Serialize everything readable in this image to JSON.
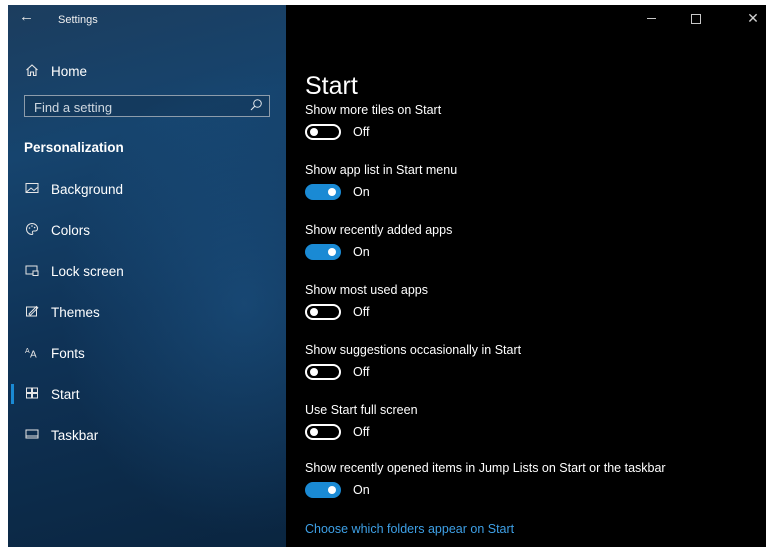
{
  "window": {
    "title": "Settings"
  },
  "sidebar": {
    "home_label": "Home",
    "search_placeholder": "Find a setting",
    "section_title": "Personalization",
    "items": [
      {
        "label": "Background",
        "icon": "picture-icon"
      },
      {
        "label": "Colors",
        "icon": "palette-icon"
      },
      {
        "label": "Lock screen",
        "icon": "lock-screen-icon"
      },
      {
        "label": "Themes",
        "icon": "themes-icon"
      },
      {
        "label": "Fonts",
        "icon": "fonts-icon"
      },
      {
        "label": "Start",
        "icon": "start-icon",
        "selected": true
      },
      {
        "label": "Taskbar",
        "icon": "taskbar-icon"
      }
    ]
  },
  "main": {
    "title": "Start",
    "settings": [
      {
        "label": "Show more tiles on Start",
        "state": "Off",
        "on": false
      },
      {
        "label": "Show app list in Start menu",
        "state": "On",
        "on": true
      },
      {
        "label": "Show recently added apps",
        "state": "On",
        "on": true
      },
      {
        "label": "Show most used apps",
        "state": "Off",
        "on": false
      },
      {
        "label": "Show suggestions occasionally in Start",
        "state": "Off",
        "on": false
      },
      {
        "label": "Use Start full screen",
        "state": "Off",
        "on": false
      },
      {
        "label": "Show recently opened items in Jump Lists on Start or the taskbar",
        "state": "On",
        "on": true
      }
    ],
    "link": "Choose which folders appear on Start"
  },
  "colors": {
    "accent": "#1a8ad4",
    "link": "#3ea0e6"
  }
}
